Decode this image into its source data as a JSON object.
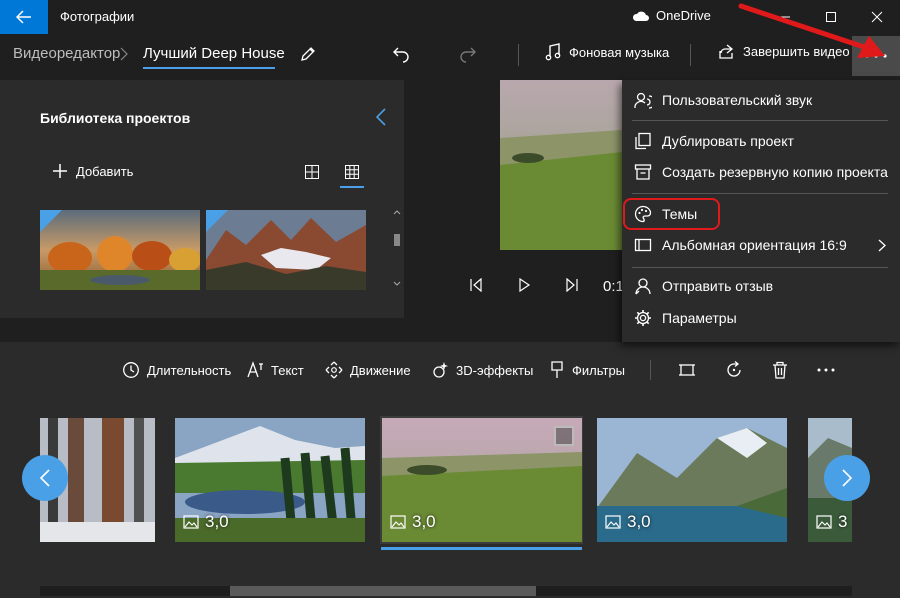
{
  "window": {
    "app_title": "Фотографии",
    "onedrive_label": "OneDrive"
  },
  "toolbar": {
    "crumb_root": "Видеоредактор",
    "project_name": "Лучший Deep House",
    "music_label": "Фоновая музыка",
    "finish_label": "Завершить видео"
  },
  "library": {
    "title": "Библиотека проектов",
    "add_label": "Добавить"
  },
  "preview": {
    "time": "0:1"
  },
  "storyboard": {
    "tools": {
      "duration": "Длительность",
      "text": "Текст",
      "motion": "Движение",
      "effects3d": "3D-эффекты",
      "filters": "Фильтры"
    },
    "cards": [
      {
        "duration": ""
      },
      {
        "duration": "3,0"
      },
      {
        "duration": "3,0"
      },
      {
        "duration": "3,0"
      },
      {
        "duration": "3"
      }
    ]
  },
  "menu": {
    "items": [
      {
        "label": "Пользовательский звук",
        "icon": "custom-audio-icon"
      },
      {
        "label": "Дублировать проект",
        "icon": "duplicate-icon"
      },
      {
        "label": "Создать резервную копию проекта",
        "icon": "backup-icon"
      },
      {
        "label": "Темы",
        "icon": "palette-icon"
      },
      {
        "label": "Альбомная ориентация 16:9",
        "icon": "aspect-ratio-icon"
      },
      {
        "label": "Отправить отзыв",
        "icon": "feedback-icon"
      },
      {
        "label": "Параметры",
        "icon": "gear-icon"
      }
    ]
  },
  "colors": {
    "accent": "#4aa0e6",
    "highlight_box": "#e0191b",
    "title_back_button": "#0078d7"
  }
}
